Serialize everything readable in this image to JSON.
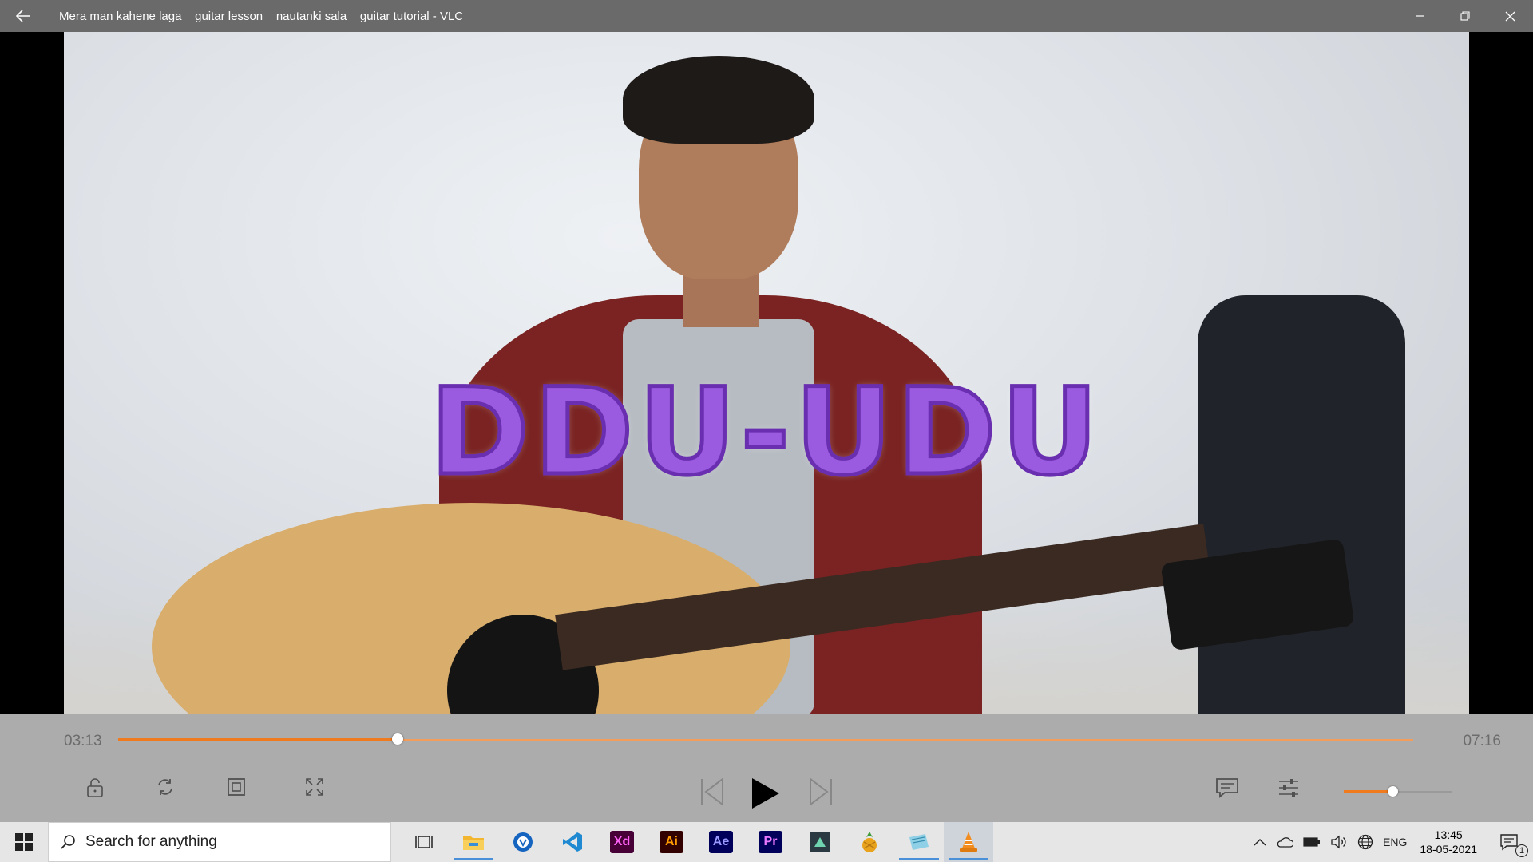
{
  "window": {
    "title": "Mera man kahene laga _ guitar lesson _ nautanki sala _ guitar tutorial - VLC",
    "back_icon": "back-arrow-icon",
    "minimize_icon": "minimize-icon",
    "restore_icon": "restore-icon",
    "close_icon": "close-icon"
  },
  "video": {
    "overlay_text": "DDU-UDU"
  },
  "player": {
    "current_time": "03:13",
    "total_time": "07:16",
    "progress_fraction": 0.216,
    "volume_fraction": 0.45,
    "accent_color": "#f07a1e",
    "left_buttons": [
      "lock-icon",
      "repeat-icon",
      "aspect-ratio-icon",
      "fullscreen-icon"
    ],
    "center_buttons": [
      "previous-icon",
      "play-icon",
      "next-icon"
    ],
    "right_buttons": [
      "subtitles-icon",
      "equalizer-icon"
    ]
  },
  "taskbar": {
    "search_placeholder": "Search for anything",
    "apps": [
      {
        "name": "task-view",
        "label": ""
      },
      {
        "name": "file-explorer",
        "label": ""
      },
      {
        "name": "app-blue",
        "label": ""
      },
      {
        "name": "vscode",
        "label": ""
      },
      {
        "name": "adobe-xd",
        "label": "Xd"
      },
      {
        "name": "adobe-illustrator",
        "label": "Ai"
      },
      {
        "name": "adobe-after-effects",
        "label": "Ae"
      },
      {
        "name": "adobe-premiere",
        "label": "Pr"
      },
      {
        "name": "app-dark",
        "label": ""
      },
      {
        "name": "app-fruit",
        "label": ""
      },
      {
        "name": "app-notes",
        "label": ""
      },
      {
        "name": "vlc",
        "label": ""
      }
    ],
    "language": "ENG",
    "time": "13:45",
    "date": "18-05-2021",
    "notification_count": "1"
  }
}
